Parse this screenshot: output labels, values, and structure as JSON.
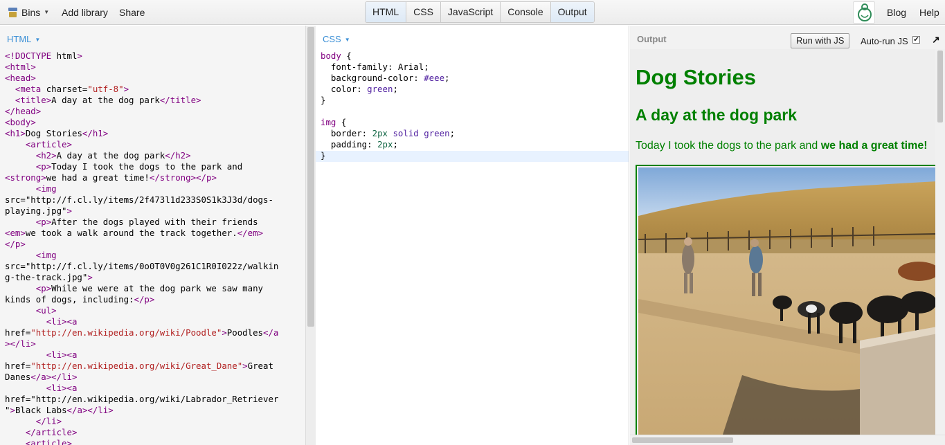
{
  "toolbar": {
    "bins_label": "Bins",
    "add_library_label": "Add library",
    "share_label": "Share",
    "panel_tabs": [
      "HTML",
      "CSS",
      "JavaScript",
      "Console",
      "Output"
    ],
    "blog_label": "Blog",
    "help_label": "Help"
  },
  "html_pane": {
    "label": "HTML",
    "lines": [
      "<!DOCTYPE html>",
      "<html>",
      "<head>",
      "  <meta charset=\"utf-8\">",
      "  <title>A day at the dog park</title>",
      "</head>",
      "<body>",
      "<h1>Dog Stories</h1>",
      "    <article>",
      "      <h2>A day at the dog park</h2>",
      "      <p>Today I took the dogs to the park and",
      "<strong>we had a great time!</strong></p>",
      "      <img",
      "src=\"http://f.cl.ly/items/2f473l1d233S0S1k3J3d/dogs-",
      "playing.jpg\">",
      "      <p>After the dogs played with their friends",
      "<em>we took a walk around the track together.</em>",
      "</p>",
      "      <img",
      "src=\"http://f.cl.ly/items/0o0T0V0g261C1R0I022z/walkin",
      "g-the-track.jpg\">",
      "      <p>While we were at the dog park we saw many",
      "kinds of dogs, including:</p>",
      "      <ul>",
      "        <li><a",
      "href=\"http://en.wikipedia.org/wiki/Poodle\">Poodles</a",
      "></li>",
      "        <li><a",
      "href=\"http://en.wikipedia.org/wiki/Great_Dane\">Great",
      "Danes</a></li>",
      "        <li><a",
      "href=\"http://en.wikipedia.org/wiki/Labrador_Retriever",
      "\">Black Labs</a></li>",
      "      </li>",
      "    </article>",
      "    <article>"
    ]
  },
  "css_pane": {
    "label": "CSS",
    "lines": [
      "body {",
      "  font-family: Arial;",
      "  background-color: #eee;",
      "  color: green;",
      "}",
      "",
      "img {",
      "  border: 2px solid green;",
      "  padding: 2px;",
      "}"
    ]
  },
  "output_pane": {
    "label": "Output",
    "run_button": "Run with JS",
    "autorun_label": "Auto-run JS",
    "autorun_checked": true,
    "popout_icon": "arrow-up-right-icon",
    "h1": "Dog Stories",
    "h2": "A day at the dog park",
    "p_text": "Today I took the dogs to the park and ",
    "p_strong": "we had a great time!"
  },
  "colors": {
    "accent": "#3b8fd6",
    "output_green": "#008000",
    "output_bg": "#eeeeee"
  }
}
